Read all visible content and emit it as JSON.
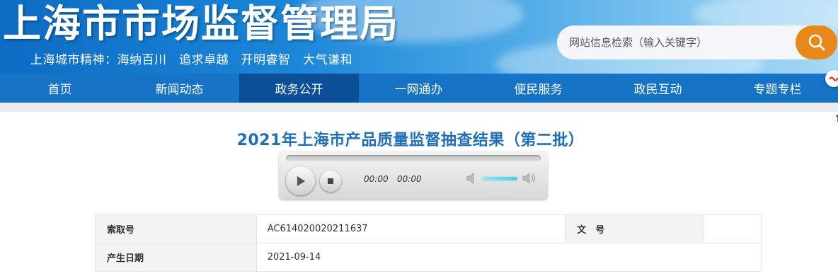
{
  "header": {
    "site_title": "上海市市场监督管理局",
    "motto": "上海城市精神：海纳百川　追求卓越　开明睿智　大气谦和",
    "search_placeholder": "网站信息检索（输入关键字）",
    "search_icon": "search-icon",
    "accent_color": "#e6881a"
  },
  "nav": {
    "items": [
      "首页",
      "新闻动态",
      "政务公开",
      "一网通办",
      "便民服务",
      "政民互动",
      "专题专栏"
    ],
    "active_index": 2,
    "color": "#1572c4",
    "active_color": "#0b4f96"
  },
  "article": {
    "title": "2021年上海市产品质量监督抽查结果（第二批）"
  },
  "player": {
    "current_time": "00:00",
    "duration": "00:00",
    "volume_level": 0.7
  },
  "meta": {
    "rows": [
      {
        "label1": "索取号",
        "value1": "AC614020020211637",
        "label2": "文　号",
        "value2": ""
      },
      {
        "label1": "产生日期",
        "value1": "2021-09-14"
      }
    ]
  }
}
